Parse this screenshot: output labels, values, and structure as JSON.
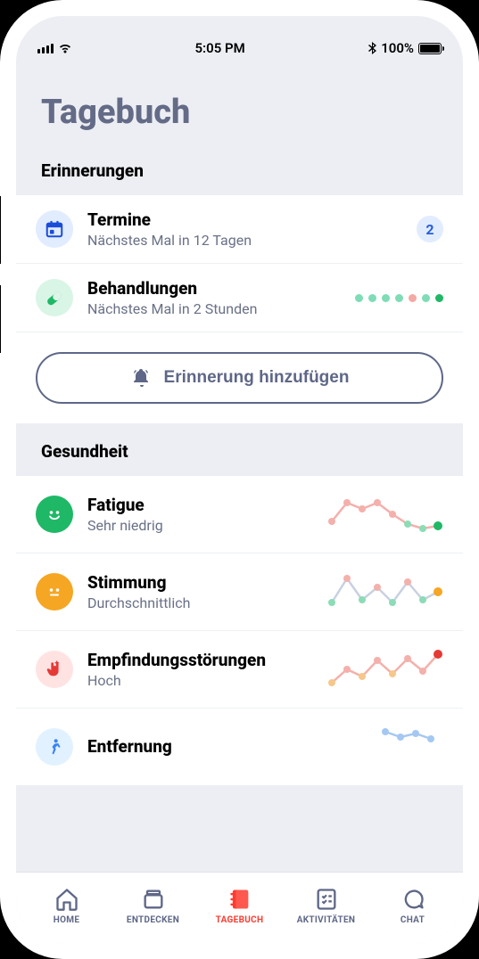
{
  "status_bar": {
    "time": "5:05 PM",
    "battery": "100%"
  },
  "page": {
    "title": "Tagebuch"
  },
  "reminders": {
    "section_title": "Erinnerungen",
    "items": [
      {
        "title": "Termine",
        "sub": "Nächstes Mal in 12 Tagen",
        "badge": "2"
      },
      {
        "title": "Behandlungen",
        "sub": "Nächstes Mal in 2 Stunden"
      }
    ],
    "add_label": "Erinnerung hinzufügen"
  },
  "health": {
    "section_title": "Gesundheit",
    "items": [
      {
        "title": "Fatigue",
        "sub": "Sehr niedrig"
      },
      {
        "title": "Stimmung",
        "sub": "Durchschnittlich"
      },
      {
        "title": "Empfindungsstörungen",
        "sub": "Hoch"
      },
      {
        "title": "Entfernung",
        "sub": ""
      }
    ]
  },
  "tabs": {
    "home": "HOME",
    "discover": "ENTDECKEN",
    "diary": "TAGEBUCH",
    "activities": "AKTIVITÄTEN",
    "chat": "CHAT"
  }
}
